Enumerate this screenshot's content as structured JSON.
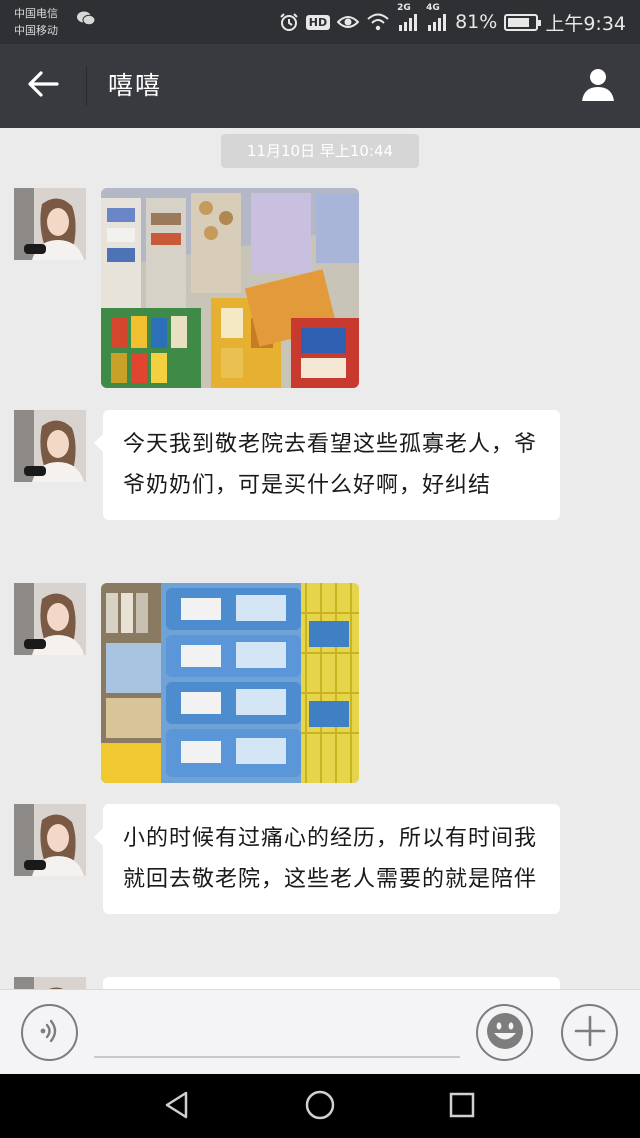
{
  "status_bar": {
    "carrier_1": "中国电信",
    "carrier_2": "中国移动",
    "hd_label": "HD",
    "network_1": "2G",
    "network_2": "4G",
    "battery_percent": "81%",
    "battery_level": 0.81,
    "time": "上午9:34",
    "icons": [
      "wechat-icon",
      "alarm-icon",
      "eye-icon",
      "wifi-icon",
      "signal-icon",
      "battery-icon"
    ]
  },
  "header": {
    "back_icon": "arrow-left-icon",
    "title": "嘻嘻",
    "profile_icon": "person-icon"
  },
  "chat": {
    "timestamp": "11月10日  早上10:44",
    "messages": [
      {
        "type": "image",
        "content": "supermarket-shelves-photo"
      },
      {
        "type": "text",
        "text": "今天我到敬老院去看望这些孤寡老人，爷爷奶奶们，可是买什么好啊，好纠结"
      },
      {
        "type": "image",
        "content": "milk-powder-shelves-photo"
      },
      {
        "type": "text",
        "text": "小的时候有过痛心的经历，所以有时间我就回去敬老院，这些老人需要的就是陪伴"
      }
    ]
  },
  "input_bar": {
    "voice_icon": "voice-icon",
    "input_value": "",
    "emoji_icon": "smiley-icon",
    "plus_icon": "plus-icon"
  },
  "nav_bar": {
    "icons": [
      "back-triangle-icon",
      "home-circle-icon",
      "recents-square-icon"
    ]
  },
  "colors": {
    "header_bg": "#393a3f",
    "status_bg": "#2e3033",
    "chat_bg": "#ebebeb",
    "bubble_bg": "#ffffff"
  }
}
